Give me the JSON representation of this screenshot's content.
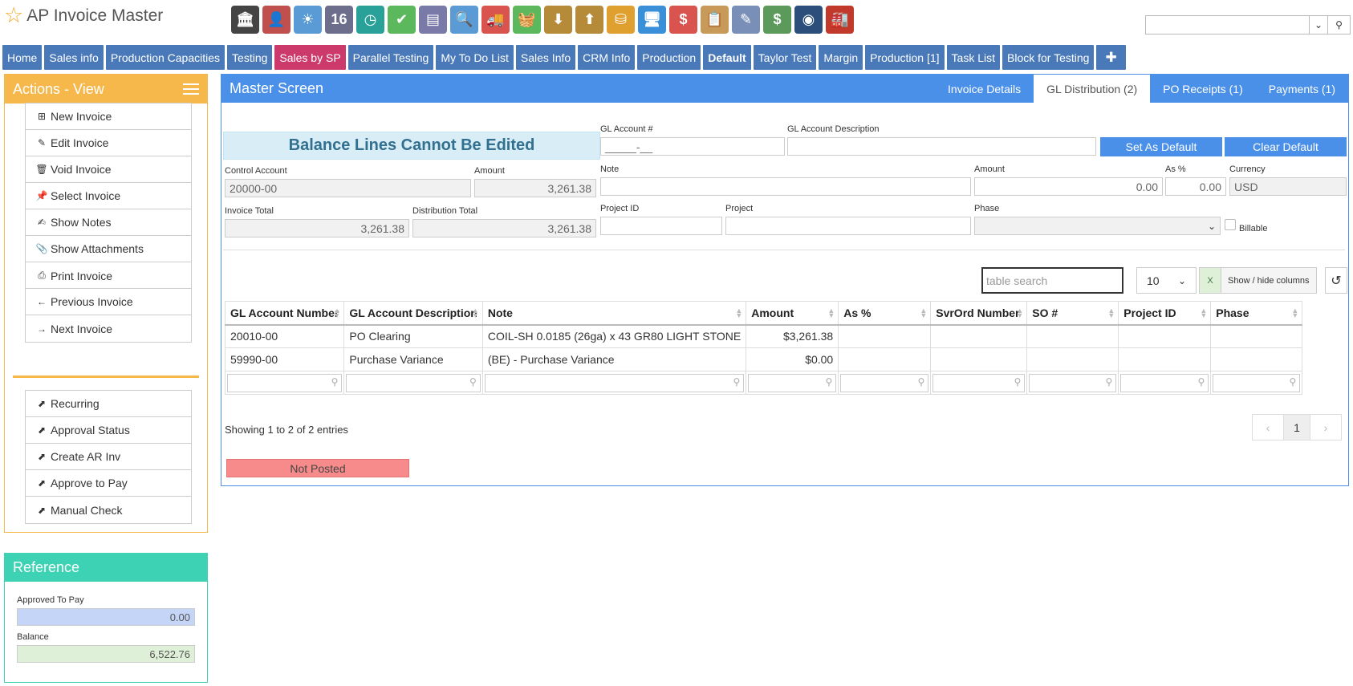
{
  "app": {
    "title": "AP Invoice Master",
    "star_icon": "star-icon"
  },
  "toolbar_icons": [
    {
      "name": "bank-icon",
      "glyph": "🏛",
      "color": "#444444"
    },
    {
      "name": "user-icon",
      "glyph": "👤",
      "color": "#c0504d"
    },
    {
      "name": "weather-icon",
      "glyph": "☀",
      "color": "#5a9bd5"
    },
    {
      "name": "calendar-icon",
      "glyph": "16",
      "color": "#6d6d8c"
    },
    {
      "name": "clock-icon",
      "glyph": "◷",
      "color": "#2aa198"
    },
    {
      "name": "checkmark-icon",
      "glyph": "✔",
      "color": "#5cb85c"
    },
    {
      "name": "register-icon",
      "glyph": "▤",
      "color": "#7a7aa8"
    },
    {
      "name": "magnifier-icon",
      "glyph": "🔍",
      "color": "#5a9bd5"
    },
    {
      "name": "truck-icon",
      "glyph": "🚚",
      "color": "#d9534f"
    },
    {
      "name": "basket-icon",
      "glyph": "🧺",
      "color": "#5cb85c"
    },
    {
      "name": "download-box-icon",
      "glyph": "⬇",
      "color": "#b58b3a"
    },
    {
      "name": "upload-box-icon",
      "glyph": "⬆",
      "color": "#b58b3a"
    },
    {
      "name": "coins-hand-icon",
      "glyph": "⛁",
      "color": "#e0a030"
    },
    {
      "name": "monitor-icon",
      "glyph": "🖥",
      "color": "#3a8fd9"
    },
    {
      "name": "dollar-chat-icon",
      "glyph": "$",
      "color": "#d9534f"
    },
    {
      "name": "clipboard-icon",
      "glyph": "📋",
      "color": "#c79a5a"
    },
    {
      "name": "pencil-icon",
      "glyph": "✎",
      "color": "#7a8fb8"
    },
    {
      "name": "cash-icon",
      "glyph": "$",
      "color": "#5c9a5c"
    },
    {
      "name": "safe-icon",
      "glyph": "◉",
      "color": "#2b4f7a"
    },
    {
      "name": "factory-icon",
      "glyph": "🏭",
      "color": "#c0392b"
    }
  ],
  "search": {
    "value": "",
    "caret_icon": "chevron-down-icon",
    "search_icon": "search-icon"
  },
  "nav": [
    {
      "label": "Home",
      "style": ""
    },
    {
      "label": "Sales info",
      "style": ""
    },
    {
      "label": "Production Capacities",
      "style": ""
    },
    {
      "label": "Testing",
      "style": ""
    },
    {
      "label": "Sales by SP",
      "style": "pink"
    },
    {
      "label": "Parallel Testing",
      "style": ""
    },
    {
      "label": "My To Do List",
      "style": ""
    },
    {
      "label": "Sales Info",
      "style": ""
    },
    {
      "label": "CRM Info",
      "style": ""
    },
    {
      "label": "Production",
      "style": ""
    },
    {
      "label": "Default",
      "style": "bold"
    },
    {
      "label": "Taylor Test",
      "style": ""
    },
    {
      "label": "Margin",
      "style": ""
    },
    {
      "label": "Production [1]",
      "style": ""
    },
    {
      "label": "Task List",
      "style": ""
    },
    {
      "label": "Block for Testing",
      "style": ""
    },
    {
      "label": "✚",
      "style": "plus"
    }
  ],
  "actions": {
    "title": "Actions - View",
    "group1": [
      {
        "label": "New Invoice",
        "icon": "plus-square-icon",
        "glyph": "⊞"
      },
      {
        "label": "Edit Invoice",
        "icon": "pencil-icon",
        "glyph": "✎"
      },
      {
        "label": "Void Invoice",
        "icon": "trash-icon",
        "glyph": "🗑"
      },
      {
        "label": "Select Invoice",
        "icon": "pin-icon",
        "glyph": "📌"
      },
      {
        "label": "Show Notes",
        "icon": "edit-note-icon",
        "glyph": "✍"
      },
      {
        "label": "Show Attachments",
        "icon": "paperclip-icon",
        "glyph": "📎"
      },
      {
        "label": "Print Invoice",
        "icon": "printer-icon",
        "glyph": "⎙"
      }
    ],
    "group2": [
      {
        "label": "Previous Invoice",
        "icon": "arrow-left-icon",
        "glyph": "←"
      },
      {
        "label": "Next Invoice",
        "icon": "arrow-right-icon",
        "glyph": "→"
      }
    ],
    "group3": [
      {
        "label": "Recurring",
        "icon": "external-link-icon",
        "glyph": "⬈"
      },
      {
        "label": "Approval Status",
        "icon": "external-link-icon",
        "glyph": "⬈"
      },
      {
        "label": "Create AR Inv",
        "icon": "external-link-icon",
        "glyph": "⬈"
      },
      {
        "label": "Approve to Pay",
        "icon": "external-link-icon",
        "glyph": "⬈"
      },
      {
        "label": "Manual Check",
        "icon": "external-link-icon",
        "glyph": "⬈"
      }
    ]
  },
  "reference": {
    "title": "Reference",
    "approved_label": "Approved To Pay",
    "approved_value": "0.00",
    "balance_label": "Balance",
    "balance_value": "6,522.76",
    "approved_color": "#c5d5f7",
    "balance_color": "#dff0d8"
  },
  "master": {
    "title": "Master Screen",
    "tabs": [
      "Invoice Details",
      "GL Distribution (2)",
      "PO Receipts (1)",
      "Payments (1)"
    ],
    "active_tab": "GL Distribution (2)",
    "banner": "Balance Lines Cannot Be Edited",
    "control_account_label": "Control Account",
    "control_account_value": "20000-00",
    "amount_label": "Amount",
    "amount_value": "3,261.38",
    "invoice_total_label": "Invoice Total",
    "invoice_total_value": "3,261.38",
    "distribution_total_label": "Distribution Total",
    "distribution_total_value": "3,261.38",
    "gl_account_label": "GL Account #",
    "gl_account_value": "_____-__",
    "gl_desc_label": "GL Account Description",
    "gl_desc_value": "",
    "set_default_label": "Set As Default",
    "clear_default_label": "Clear Default",
    "note_label": "Note",
    "note_value": "",
    "line_amount_label": "Amount",
    "line_amount_value": "0.00",
    "as_pct_label": "As %",
    "as_pct_value": "0.00",
    "currency_label": "Currency",
    "currency_value": "USD",
    "project_id_label": "Project ID",
    "project_id_value": "",
    "project_label": "Project",
    "project_value": "",
    "phase_label": "Phase",
    "phase_value": "",
    "billable_label": "Billable",
    "table_search_placeholder": "table search",
    "page_size": "10",
    "excel_icon": "excel-icon",
    "show_hide_label": "Show / hide columns",
    "reset_icon": "reset-icon",
    "columns": [
      "GL Account Number",
      "GL Account Description",
      "Note",
      "Amount",
      "As %",
      "SvrOrd Number",
      "SO #",
      "Project ID",
      "Phase"
    ],
    "rows": [
      [
        "20010-00",
        "PO Clearing",
        "COIL-SH 0.0185 (26ga) x 43 GR80 LIGHT STONE",
        "$3,261.38",
        "",
        "",
        "",
        "",
        ""
      ],
      [
        "59990-00",
        "Purchase Variance",
        "(BE) - Purchase Variance",
        "$0.00",
        "",
        "",
        "",
        "",
        ""
      ]
    ],
    "showing_text": "Showing 1 to 2 of 2 entries",
    "pager": {
      "prev": "‹",
      "current": "1",
      "next": "›"
    },
    "status": "Not Posted"
  }
}
